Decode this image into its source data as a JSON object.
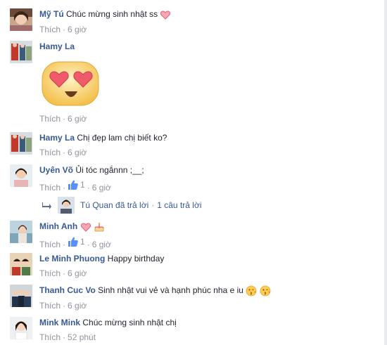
{
  "comments": [
    {
      "author": "Mỹ Tú",
      "text": "Chúc mừng sinh nhật ss",
      "like_label": "Thích",
      "time": "6 giờ",
      "likes": ""
    },
    {
      "author": "Hamy La",
      "text": "",
      "like_label": "Thích",
      "time": "6 giờ",
      "likes": ""
    },
    {
      "author": "Hamy La",
      "text": "Chị đẹp lam chị biết ko?",
      "like_label": "Thích",
      "time": "6 giờ",
      "likes": ""
    },
    {
      "author": "Uyên Võ",
      "text": "Ủi tóc ngắnnn ;__;",
      "like_label": "Thích",
      "time": "6 giờ",
      "likes": "1"
    },
    {
      "author": "Minh Anh",
      "text": "",
      "like_label": "Thích",
      "time": "6 giờ",
      "likes": "1"
    },
    {
      "author": "Le Minh Phuong",
      "text": "Happy birthday",
      "like_label": "Thích",
      "time": "6 giờ",
      "likes": ""
    },
    {
      "author": "Thanh Cuc Vo",
      "text": "Sinh nhật vui vẻ và hạnh phúc nha e iu",
      "like_label": "Thích",
      "time": "6 giờ",
      "likes": ""
    },
    {
      "author": "Mink Mink",
      "text": "Chúc mừng sinh nhật chị",
      "like_label": "Thích",
      "time": "52 phút",
      "likes": ""
    }
  ],
  "reply": {
    "text": "Tú Quan đã trả lời",
    "separator": "·",
    "count_text": "1 câu trả lời"
  },
  "separator": "·",
  "colors": {
    "link": "#365899",
    "meta": "#90949c",
    "like_thumb": "#5890ff"
  },
  "icons": {
    "heart": "heart-icon",
    "thumb": "like-thumb-icon",
    "reply_arrow": "reply-arrow-icon",
    "sticker": "heart-eyes-sticker-icon"
  }
}
